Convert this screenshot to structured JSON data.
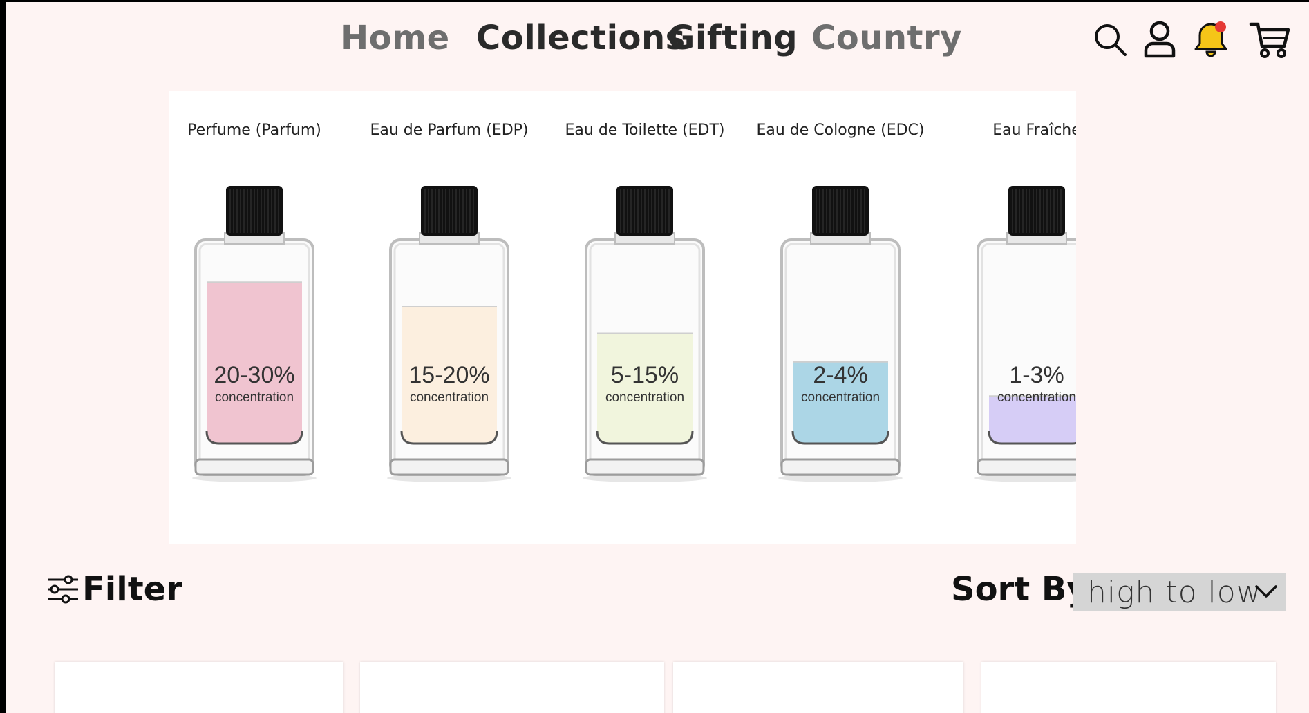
{
  "nav": {
    "links": [
      "Home",
      "Collections",
      "Gifting",
      "Country"
    ],
    "icons": [
      "search-icon",
      "user-icon",
      "bell-icon",
      "cart-icon"
    ],
    "notification_dot_color": "#e53935",
    "bell_color": "#f5c518"
  },
  "hero": {
    "bottles": [
      {
        "title": "Perfume (Parfum)",
        "percent": "20-30%",
        "label": "concentration",
        "fill_color": "#f0c4d0",
        "fill_level": 0.85
      },
      {
        "title": "Eau de Parfum (EDP)",
        "percent": "15-20%",
        "label": "concentration",
        "fill_color": "#fcefdf",
        "fill_level": 0.72
      },
      {
        "title": "Eau de Toilette (EDT)",
        "percent": "5-15%",
        "label": "concentration",
        "fill_color": "#f1f5dd",
        "fill_level": 0.58
      },
      {
        "title": "Eau de Cologne (EDC)",
        "percent": "2-4%",
        "label": "concentration",
        "fill_color": "#acd6e6",
        "fill_level": 0.43
      },
      {
        "title": "Eau Fraîche",
        "percent": "1-3%",
        "label": "concentration",
        "fill_color": "#d6cdf6",
        "fill_level": 0.25
      }
    ]
  },
  "toolbar": {
    "filter_label": "Filter",
    "sort_label": "Sort By:",
    "sort_value": "high to low"
  }
}
